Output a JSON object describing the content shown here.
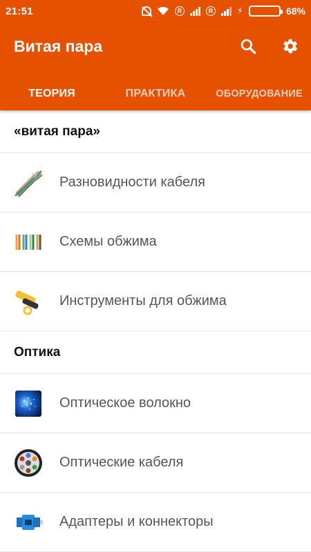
{
  "status_bar": {
    "time": "21:51",
    "battery_percent": "68%",
    "battery_level": 0.68,
    "icons": [
      "notifications-off-icon",
      "wifi-icon",
      "roaming-icon",
      "signal-icon",
      "roaming-icon",
      "signal-icon",
      "charging-icon",
      "battery-icon"
    ]
  },
  "app_bar": {
    "title": "Витая пара",
    "actions": [
      "search-icon",
      "settings-icon"
    ],
    "color": "#e65100"
  },
  "tabs": [
    {
      "label": "ТЕОРИЯ",
      "active": true
    },
    {
      "label": "ПРАКТИКА",
      "active": false
    },
    {
      "label": "ОБОРУДОВАНИЕ",
      "active": false
    }
  ],
  "sections": [
    {
      "title": "«витая пара»",
      "items": [
        {
          "label": "Разновидности кабеля",
          "icon": "cable-types-icon"
        },
        {
          "label": "Схемы обжима",
          "icon": "crimp-schemes-icon"
        },
        {
          "label": "Инструменты для обжима",
          "icon": "crimp-tool-icon"
        }
      ]
    },
    {
      "title": "Оптика",
      "items": [
        {
          "label": "Оптическое волокно",
          "icon": "optical-fiber-icon"
        },
        {
          "label": "Оптические кабеля",
          "icon": "optical-cable-icon"
        },
        {
          "label": "Адаптеры и коннекторы",
          "icon": "adapter-connector-icon"
        }
      ]
    }
  ]
}
